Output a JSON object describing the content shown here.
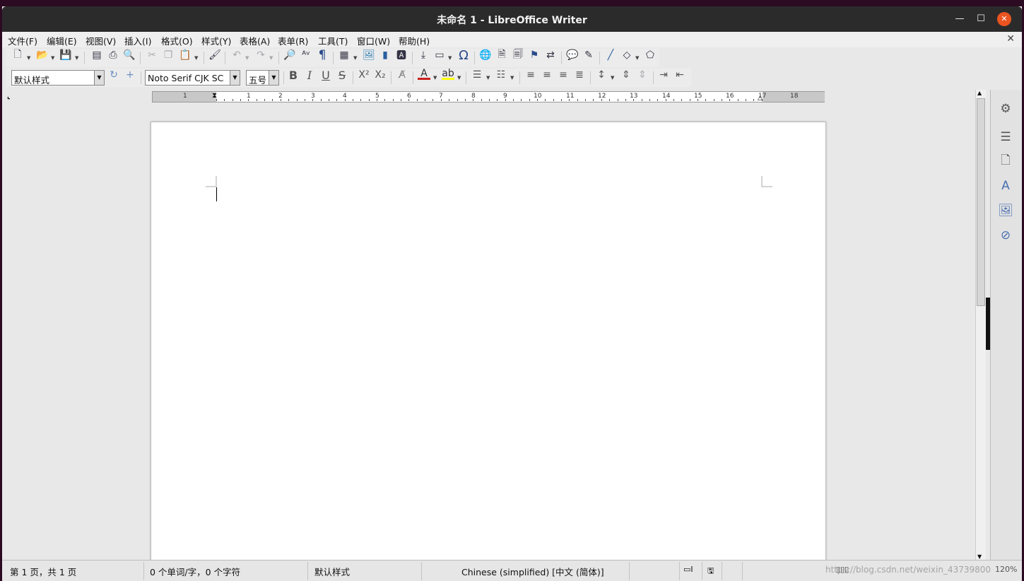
{
  "window": {
    "title": "未命名 1 - LibreOffice Writer",
    "minimize": "—",
    "maximize": "☐",
    "close": "✕"
  },
  "menubar": {
    "items": [
      "文件(F)",
      "编辑(E)",
      "视图(V)",
      "插入(I)",
      "格式(O)",
      "样式(Y)",
      "表格(A)",
      "表单(R)",
      "工具(T)",
      "窗口(W)",
      "帮助(H)"
    ],
    "close": "✕"
  },
  "toolbar": {
    "standard_icons": [
      "new-icon",
      "open-icon",
      "save-icon",
      "export-pdf-icon",
      "print-icon",
      "print-preview-icon",
      "cut-icon",
      "copy-icon",
      "paste-icon",
      "clone-formatting-icon",
      "undo-icon",
      "redo-icon",
      "find-replace-icon",
      "spelling-icon",
      "formatting-marks-icon",
      "table-icon",
      "image-icon",
      "chart-icon",
      "textbox-icon",
      "page-break-icon",
      "field-icon",
      "special-character-icon",
      "hyperlink-icon",
      "footnote-icon",
      "endnote-icon",
      "bookmark-icon",
      "cross-reference-icon",
      "comment-icon",
      "track-changes-icon",
      "line-icon",
      "shapes-icon",
      "draw-functions-icon"
    ],
    "paragraph_style": "默认样式",
    "font_name": "Noto Serif CJK SC",
    "font_size": "五号"
  },
  "ruler": {
    "labels": [
      "1",
      "1",
      "2",
      "3",
      "4",
      "5",
      "6",
      "7",
      "8",
      "9",
      "10",
      "11",
      "12",
      "13",
      "14",
      "15",
      "16",
      "17",
      "18"
    ]
  },
  "status": {
    "page": "第 1 页，共 1 页",
    "words": "0 个单词/字，0 个字符",
    "style": "默认样式",
    "language": "Chinese (simplified) [中文 (简体)]",
    "zoom": "120%",
    "watermark": "https://blog.csdn.net/weixin_43739800"
  },
  "colors": {
    "accent": "#e95420",
    "titlebar": "#2b2b2b",
    "font_color": "#c9211e",
    "highlight": "#ffff00"
  }
}
